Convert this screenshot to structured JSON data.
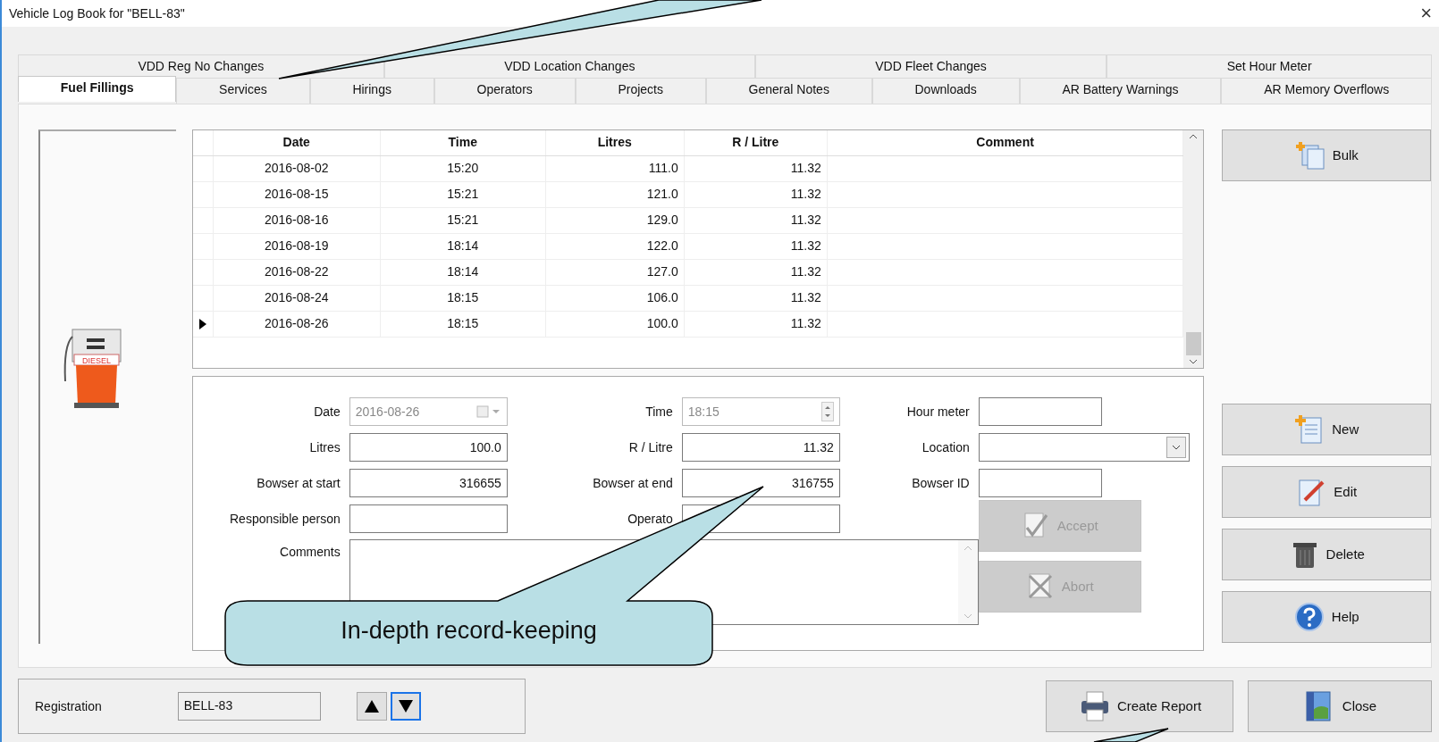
{
  "window": {
    "title": "Vehicle Log Book for \"BELL-83\"",
    "close_glyph": "×"
  },
  "tabs_row1": [
    {
      "label": "VDD Reg No Changes",
      "selected": false
    },
    {
      "label": "VDD Location Changes",
      "selected": false
    },
    {
      "label": "VDD Fleet Changes",
      "selected": false
    },
    {
      "label": "Set Hour Meter",
      "selected": false
    }
  ],
  "tabs_row2": [
    {
      "label": "Fuel Fillings",
      "selected": true
    },
    {
      "label": "Services",
      "selected": false
    },
    {
      "label": "Hirings",
      "selected": false
    },
    {
      "label": "Operators",
      "selected": false
    },
    {
      "label": "Projects",
      "selected": false
    },
    {
      "label": "General Notes",
      "selected": false
    },
    {
      "label": "Downloads",
      "selected": false
    },
    {
      "label": "AR Battery Warnings",
      "selected": false
    },
    {
      "label": "AR Memory Overflows",
      "selected": false
    }
  ],
  "pump_label": "DIESEL",
  "grid": {
    "columns": [
      "Date",
      "Time",
      "Litres",
      "R / Litre",
      "Comment"
    ],
    "rows": [
      {
        "date": "2016-08-02",
        "time": "15:20",
        "litres": "111.0",
        "r_per_litre": "11.32",
        "selected": false
      },
      {
        "date": "2016-08-15",
        "time": "15:21",
        "litres": "121.0",
        "r_per_litre": "11.32",
        "selected": false
      },
      {
        "date": "2016-08-16",
        "time": "15:21",
        "litres": "129.0",
        "r_per_litre": "11.32",
        "selected": false
      },
      {
        "date": "2016-08-19",
        "time": "18:14",
        "litres": "122.0",
        "r_per_litre": "11.32",
        "selected": false
      },
      {
        "date": "2016-08-22",
        "time": "18:14",
        "litres": "127.0",
        "r_per_litre": "11.32",
        "selected": false
      },
      {
        "date": "2016-08-24",
        "time": "18:15",
        "litres": "106.0",
        "r_per_litre": "11.32",
        "selected": false
      },
      {
        "date": "2016-08-26",
        "time": "18:15",
        "litres": "100.0",
        "r_per_litre": "11.32",
        "selected": true
      }
    ]
  },
  "bulk_button": {
    "label": "Bulk"
  },
  "form": {
    "fields": [
      {
        "label": "Date",
        "kind": "date",
        "value": "2016-08-26",
        "disabled": true
      },
      {
        "label": "Time",
        "kind": "spin",
        "value": "18:15",
        "disabled": true
      },
      {
        "label": "Hour meter",
        "kind": "text",
        "disabled": false
      },
      {
        "label": "Litres",
        "kind": "text",
        "value": "100.0",
        "disabled": false
      },
      {
        "label": "R / Litre",
        "kind": "text",
        "value": "11.32",
        "disabled": false
      },
      {
        "label": "Location",
        "kind": "combo",
        "disabled": false
      },
      {
        "label": "Bowser at start",
        "kind": "text",
        "value": "316655",
        "disabled": false
      },
      {
        "label": "Bowser at end",
        "kind": "text",
        "value": "316755",
        "disabled": false
      },
      {
        "label": "Bowser ID",
        "kind": "text",
        "disabled": false
      },
      {
        "label": "Responsible person",
        "kind": "text",
        "disabled": false
      },
      {
        "label": "Operato",
        "kind": "text",
        "disabled": false
      },
      {
        "label": "Comments",
        "kind": "textarea",
        "disabled": false
      }
    ],
    "buttons": [
      {
        "label": "Accept",
        "disabled": true
      },
      {
        "label": "Abort",
        "disabled": true
      }
    ]
  },
  "action_buttons": [
    {
      "label": "New"
    },
    {
      "label": "Edit"
    },
    {
      "label": "Delete"
    },
    {
      "label": "Help"
    }
  ],
  "registration": {
    "label": "Registration",
    "value": "BELL-83",
    "nav": [
      {
        "focused": false
      },
      {
        "focused": true
      }
    ]
  },
  "footer_buttons": [
    {
      "label": "Create Report"
    },
    {
      "label": "Close"
    }
  ],
  "callout": {
    "text": "In-depth record-keeping"
  }
}
